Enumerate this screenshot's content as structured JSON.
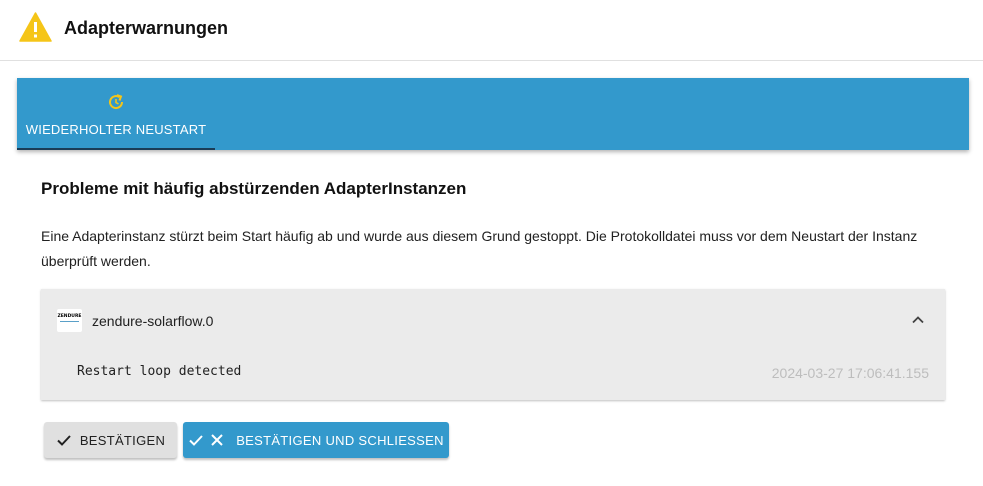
{
  "dialog": {
    "title": "Adapterwarnungen",
    "icon": "warning-icon",
    "accent_color": "#f5c518"
  },
  "tabs": [
    {
      "label": "WIEDERHOLTER NEUSTART",
      "icon": "restart-icon",
      "selected": true
    }
  ],
  "tabbar_color": "#3399cc",
  "content": {
    "heading": "Probleme mit häufig abstürzenden AdapterInstanzen",
    "description": "Eine Adapterinstanz stürzt beim Start häufig ab und wurde aus diesem Grund gestoppt. Die Protokolldatei muss vor dem Neustart der Instanz überprüft werden."
  },
  "instance": {
    "name": "zendure-solarflow.0",
    "logo_text": "ZENDURE",
    "expanded": true,
    "message": "Restart loop detected",
    "timestamp": "2024-03-27 17:06:41.155"
  },
  "buttons": {
    "confirm": "BESTÄTIGEN",
    "confirm_close": "BESTÄTIGEN UND SCHLIESSEN"
  }
}
